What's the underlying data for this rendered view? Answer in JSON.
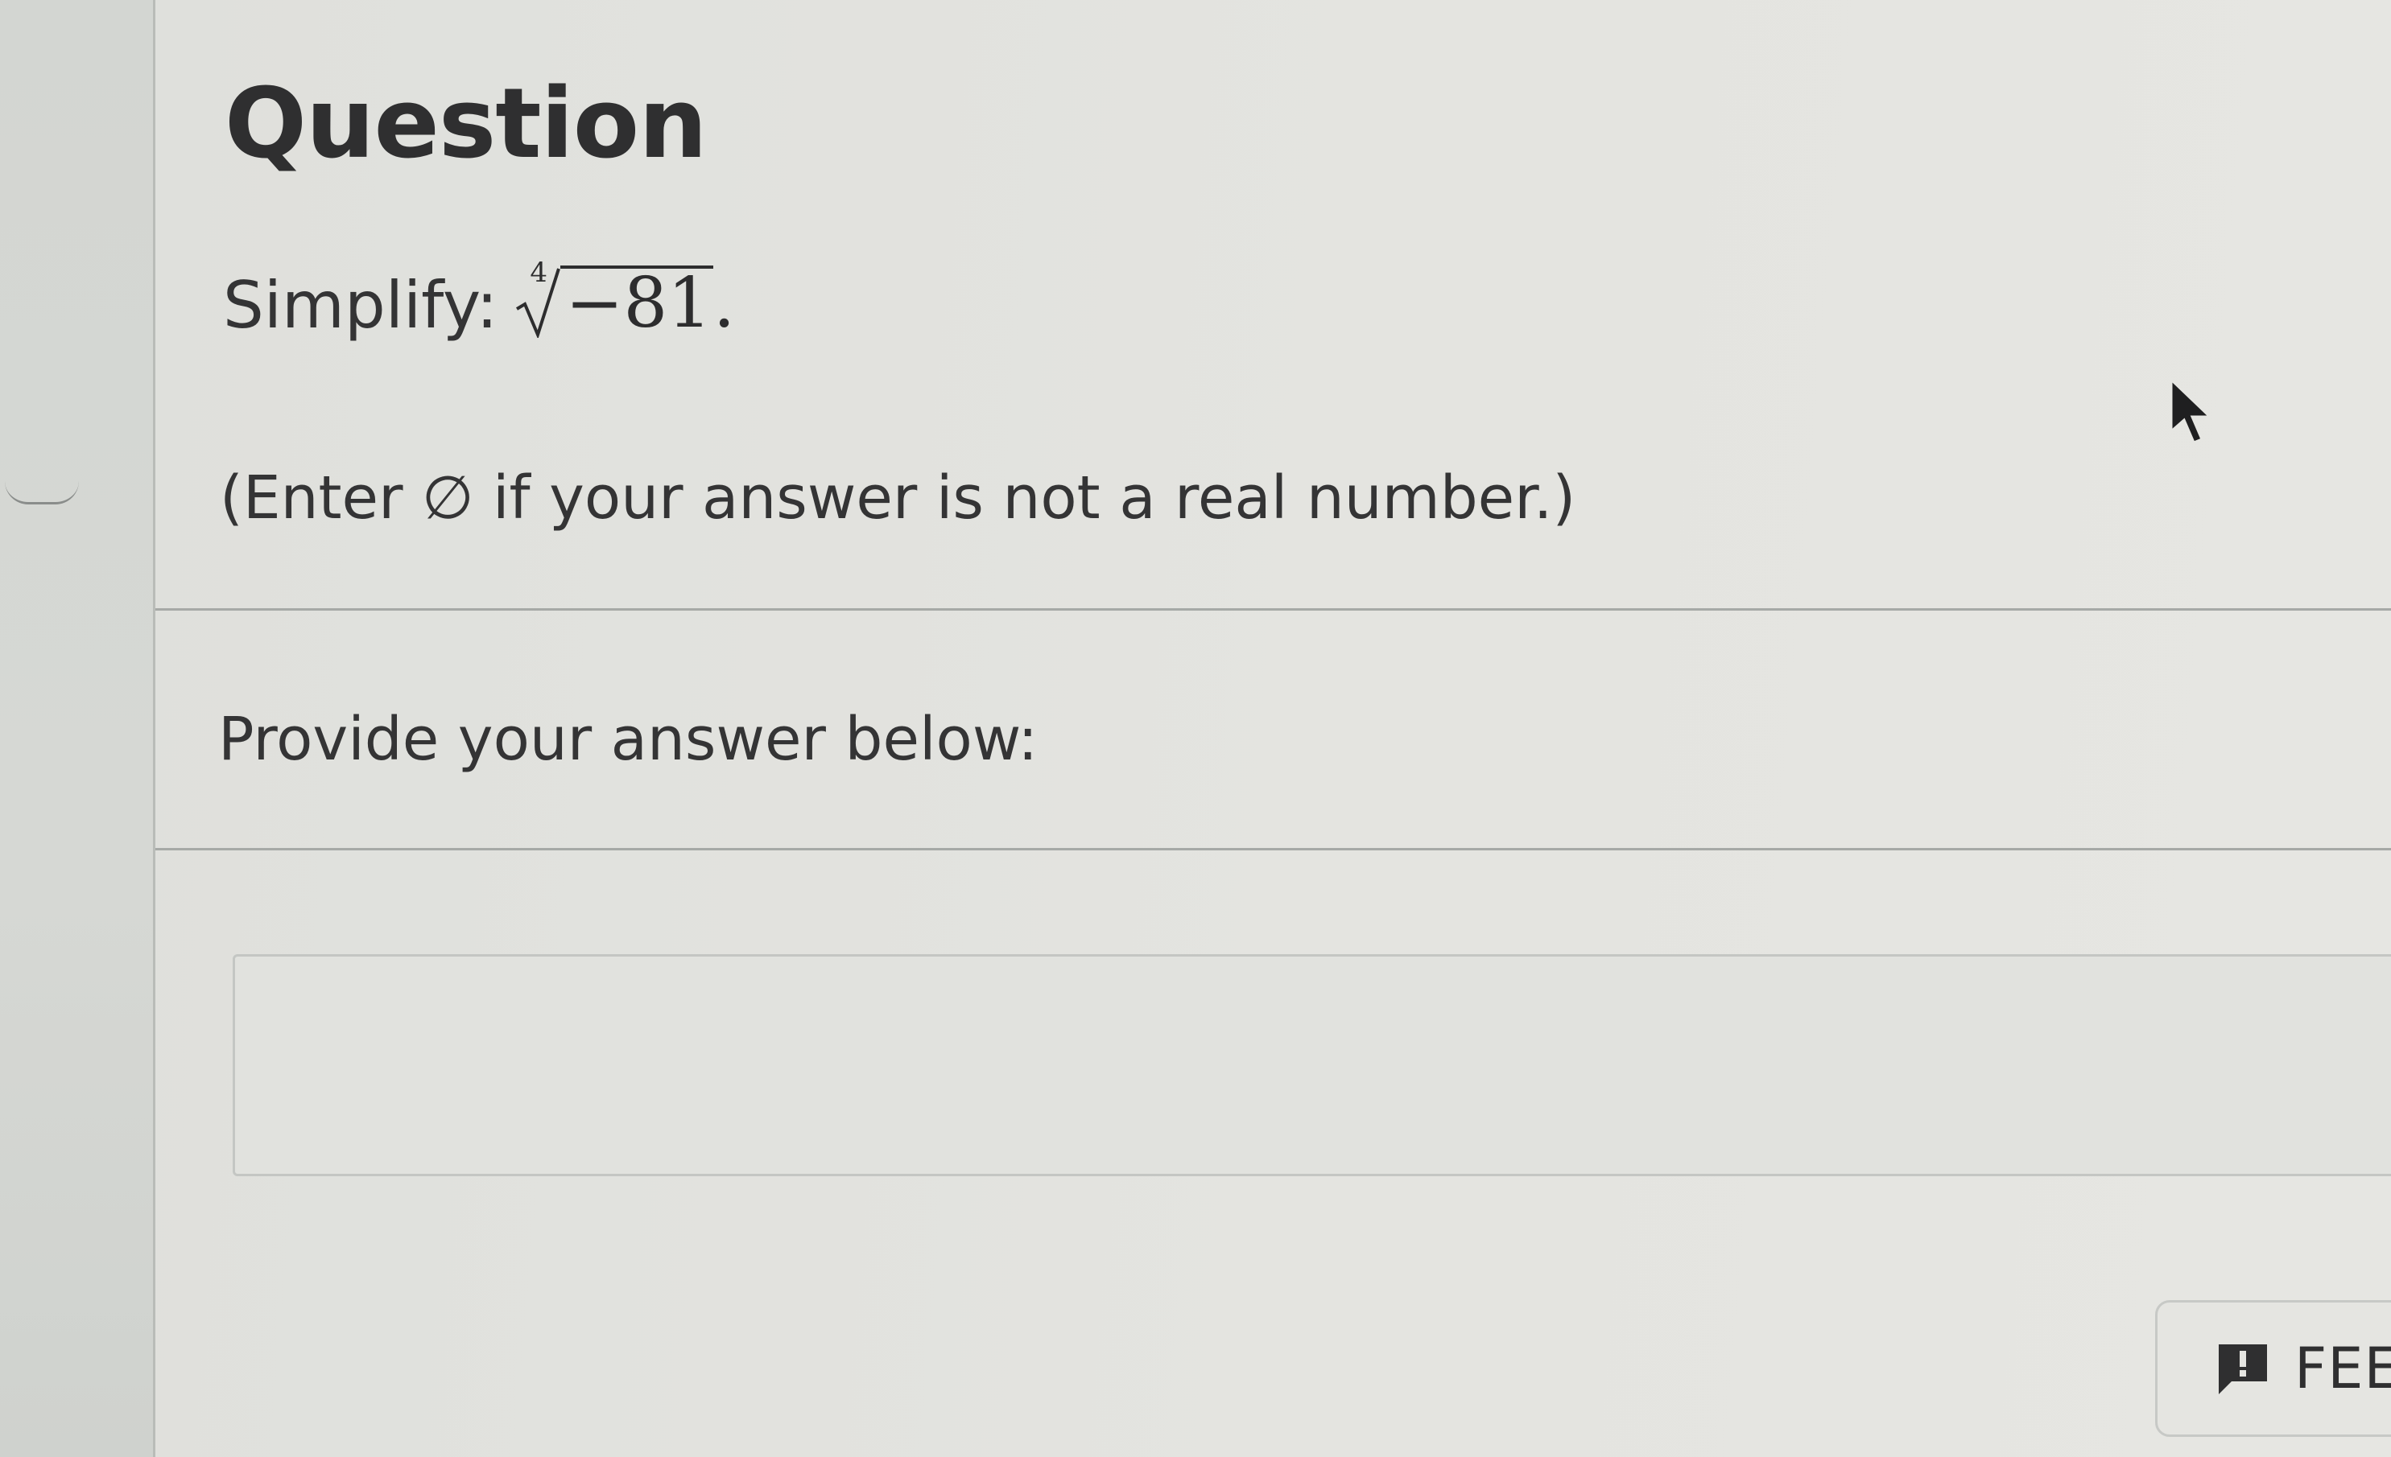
{
  "question": {
    "title": "Question",
    "prefix": "Simplify:",
    "radical_index": "4",
    "radicand": "−81",
    "suffix": ".",
    "hint": "(Enter ∅ if your answer is not a real number.)"
  },
  "answer": {
    "prompt": "Provide your answer below:",
    "value": ""
  },
  "feedback": {
    "label": "FEE",
    "icon": "feedback-flag-icon"
  },
  "colors": {
    "background": "#e2e2de",
    "text": "#343435",
    "divider": "#a6a9a6"
  }
}
